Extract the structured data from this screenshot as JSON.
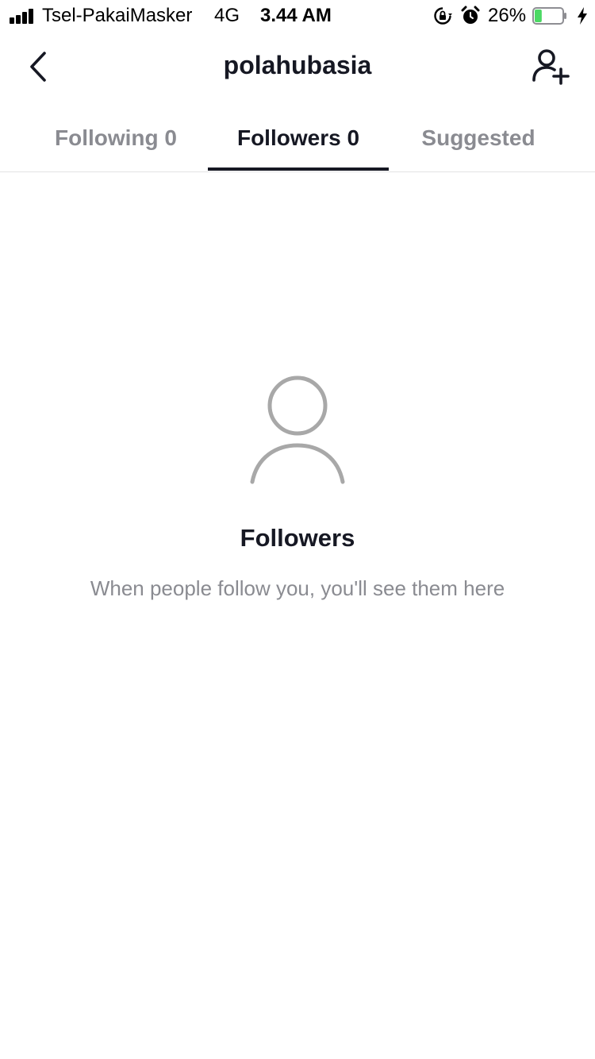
{
  "status_bar": {
    "carrier": "Tsel-PakaiMasker",
    "network": "4G",
    "time": "3.44 AM",
    "battery_percent": "26%",
    "battery_level": 0.26,
    "battery_color": "#4cd964",
    "icons": [
      "signal-icon",
      "rotation-lock-icon",
      "alarm-icon",
      "battery-icon",
      "charging-icon"
    ]
  },
  "header": {
    "title": "polahubasia",
    "back_icon": "chevron-left-icon",
    "add_user_icon": "add-user-icon"
  },
  "tabs": {
    "items": [
      {
        "label": "Following 0",
        "active": false
      },
      {
        "label": "Followers 0",
        "active": true
      },
      {
        "label": "Suggested",
        "active": false
      }
    ]
  },
  "empty_state": {
    "icon": "person-outline-icon",
    "title": "Followers",
    "message": "When people follow you, you'll see them here"
  },
  "colors": {
    "text_primary": "#161823",
    "text_secondary": "#8a8b91",
    "icon_gray": "#a8a8a8",
    "divider": "#e3e3e4"
  }
}
